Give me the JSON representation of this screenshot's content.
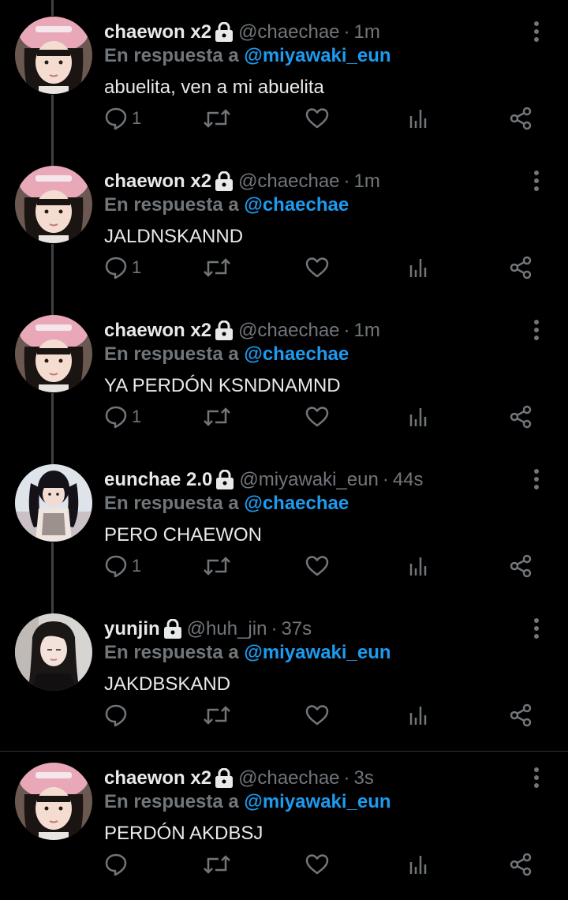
{
  "colors": {
    "background": "#000000",
    "primary_text": "#e7e9ea",
    "secondary_text": "#71767b",
    "accent": "#1d9bf0",
    "thread_line": "#3e4144",
    "separator": "#2f3336"
  },
  "tweets": [
    {
      "name": "chaewon x2",
      "handle": "@chaechae",
      "time": "1m",
      "reply_prefix": "En respuesta a",
      "reply_to": "@miyawaki_eun",
      "text": "abuelita, ven a mi abuelita",
      "reply_count": "1",
      "avatar": "pink-hat-avatar"
    },
    {
      "name": "chaewon x2",
      "handle": "@chaechae",
      "time": "1m",
      "reply_prefix": "En respuesta a",
      "reply_to": "@chaechae",
      "text": "JALDNSKANND",
      "reply_count": "1",
      "avatar": "pink-hat-avatar"
    },
    {
      "name": "chaewon x2",
      "handle": "@chaechae",
      "time": "1m",
      "reply_prefix": "En respuesta a",
      "reply_to": "@chaechae",
      "text": "YA PERDÓN KSNDNAMND",
      "reply_count": "1",
      "avatar": "pink-hat-avatar"
    },
    {
      "name": "eunchae 2.0",
      "handle": "@miyawaki_eun",
      "time": "44s",
      "reply_prefix": "En respuesta a",
      "reply_to": "@chaechae",
      "text": "PERO CHAEWON",
      "reply_count": "1",
      "avatar": "pigtails-avatar"
    },
    {
      "name": "yunjin",
      "handle": "@huh_jin",
      "time": "37s",
      "reply_prefix": "En respuesta a",
      "reply_to": "@miyawaki_eun",
      "text": "JAKDBSKAND",
      "reply_count": "",
      "avatar": "dark-hair-avatar"
    },
    {
      "name": "chaewon x2",
      "handle": "@chaechae",
      "time": "3s",
      "reply_prefix": "En respuesta a",
      "reply_to": "@miyawaki_eun",
      "text": "PERDÓN AKDBSJ",
      "reply_count": "",
      "avatar": "pink-hat-avatar"
    }
  ]
}
